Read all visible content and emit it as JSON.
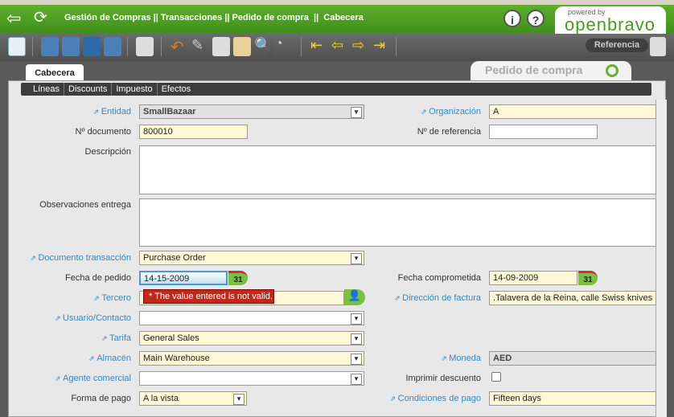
{
  "header": {
    "breadcrumb": "Gestión de Compras || Transacciones || Pedido de compra  ||  Cabecera",
    "info_icon": "i",
    "help_icon": "?",
    "logo_powered": "powered by",
    "logo_name": "openbravo"
  },
  "toolbar": {
    "reference_label": "Referencia"
  },
  "tabs": {
    "active": "Cabecera",
    "window_title": "Pedido de compra",
    "subtabs": [
      "Líneas",
      "Discounts",
      "Impuesto",
      "Efectos"
    ]
  },
  "form": {
    "entidad": {
      "label": "Entidad",
      "value": "SmallBazaar"
    },
    "organizacion": {
      "label": "Organización",
      "value": "A"
    },
    "num_documento": {
      "label": "Nº documento",
      "value": "800010"
    },
    "num_referencia": {
      "label": "Nº de referencia",
      "value": ""
    },
    "descripcion": {
      "label": "Descripción",
      "value": ""
    },
    "observaciones": {
      "label": "Observaciones entrega",
      "value": ""
    },
    "doc_transaccion": {
      "label": "Documento transacción",
      "value": "Purchase Order"
    },
    "fecha_pedido": {
      "label": "Fecha de pedido",
      "value": "14-15-2009"
    },
    "fecha_comprometida": {
      "label": "Fecha comprometida",
      "value": "14-09-2009"
    },
    "calendar_label": "31",
    "error": "* The value entered is not valid.",
    "tercero": {
      "label": "Tercero",
      "value": ""
    },
    "direccion_factura": {
      "label": "Dirección de factura",
      "value": ".Talavera de la Reina, calle Swiss knives"
    },
    "usuario": {
      "label": "Usuario/Contacto",
      "value": ""
    },
    "tarifa": {
      "label": "Tarifa",
      "value": "General Sales"
    },
    "almacen": {
      "label": "Almacén",
      "value": "Main Warehouse"
    },
    "moneda": {
      "label": "Moneda",
      "value": "AED"
    },
    "agente": {
      "label": "Agente comercial",
      "value": ""
    },
    "imprimir_descuento": {
      "label": "Imprimir descuento",
      "checked": false
    },
    "forma_pago": {
      "label": "Forma de pago",
      "value": "A la vista"
    },
    "condiciones_pago": {
      "label": "Condiciones de pago",
      "value": "Fifteen days"
    }
  }
}
